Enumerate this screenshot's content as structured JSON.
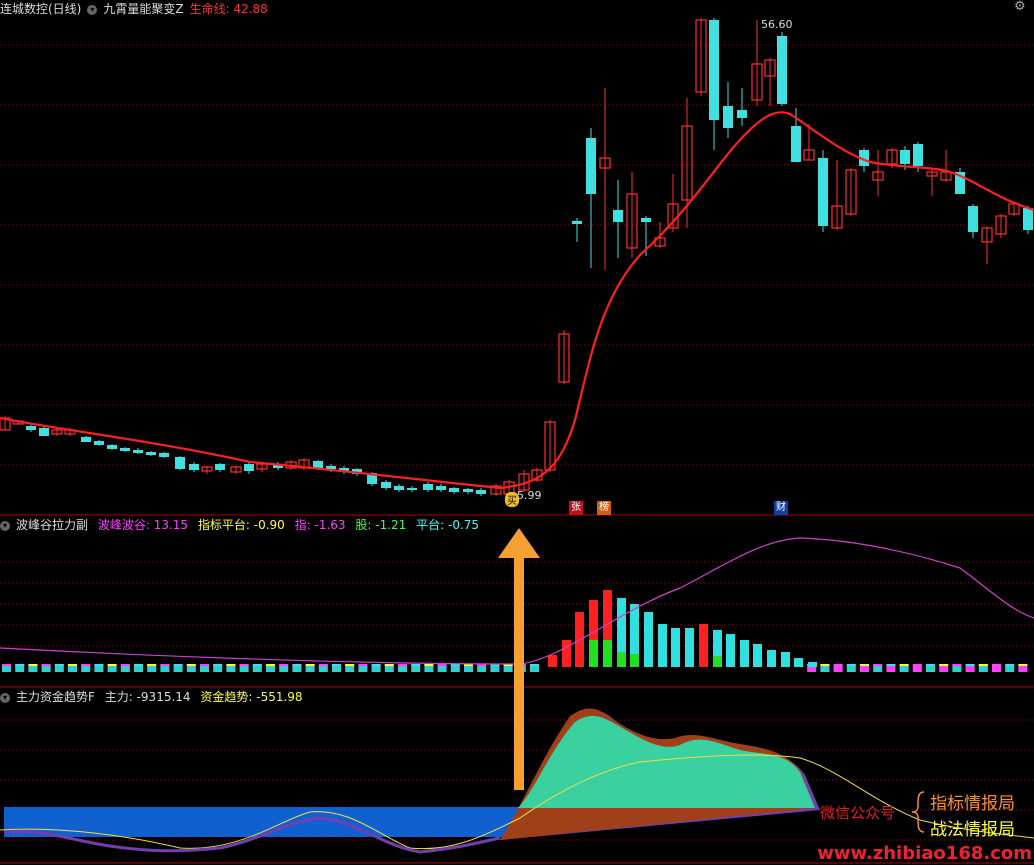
{
  "main_panel": {
    "stock_name": "连城数控(日线)",
    "indicator_name": "九霄量能聚变Z",
    "lifeline_label": "生命线: 42.88",
    "high_label": "56.60",
    "low_label": "5.99",
    "buy_label": "买",
    "badges": [
      "张",
      "榜",
      "财"
    ]
  },
  "sub_panel_1": {
    "name": "波峰谷拉力副",
    "metrics": [
      {
        "label": "波峰波谷: 13.15",
        "color": "#ff40ff"
      },
      {
        "label": "指标平台: -0.90",
        "color": "#ffff40"
      },
      {
        "label": "指: -1.63",
        "color": "#ff40ff"
      },
      {
        "label": "股: -1.21",
        "color": "#40ff40"
      },
      {
        "label": "平台: -0.75",
        "color": "#40ffff"
      }
    ]
  },
  "sub_panel_2": {
    "name": "主力资金趋势F",
    "metrics": [
      {
        "label": "主力: -9315.14",
        "color": "#dddddd"
      },
      {
        "label": "资金趋势: -551.98",
        "color": "#ffff40"
      }
    ]
  },
  "overlay": {
    "wechat_label": "微信公众号",
    "line1": "指标情报局",
    "line2": "战法情报局",
    "footer": "www.zhibiao168.com"
  },
  "watermark": "指标网: www.zhibiao168.com",
  "colors": {
    "up": "#ff3030",
    "down": "#40e0e0",
    "lifeline": "#ff2020",
    "panel_border": "#b00000",
    "brown_area": "#a0401a",
    "teal_area": "#3ad0a0",
    "purple_area": "#7040b0",
    "blue_area": "#1060d0",
    "arrow": "#f5a030"
  }
}
